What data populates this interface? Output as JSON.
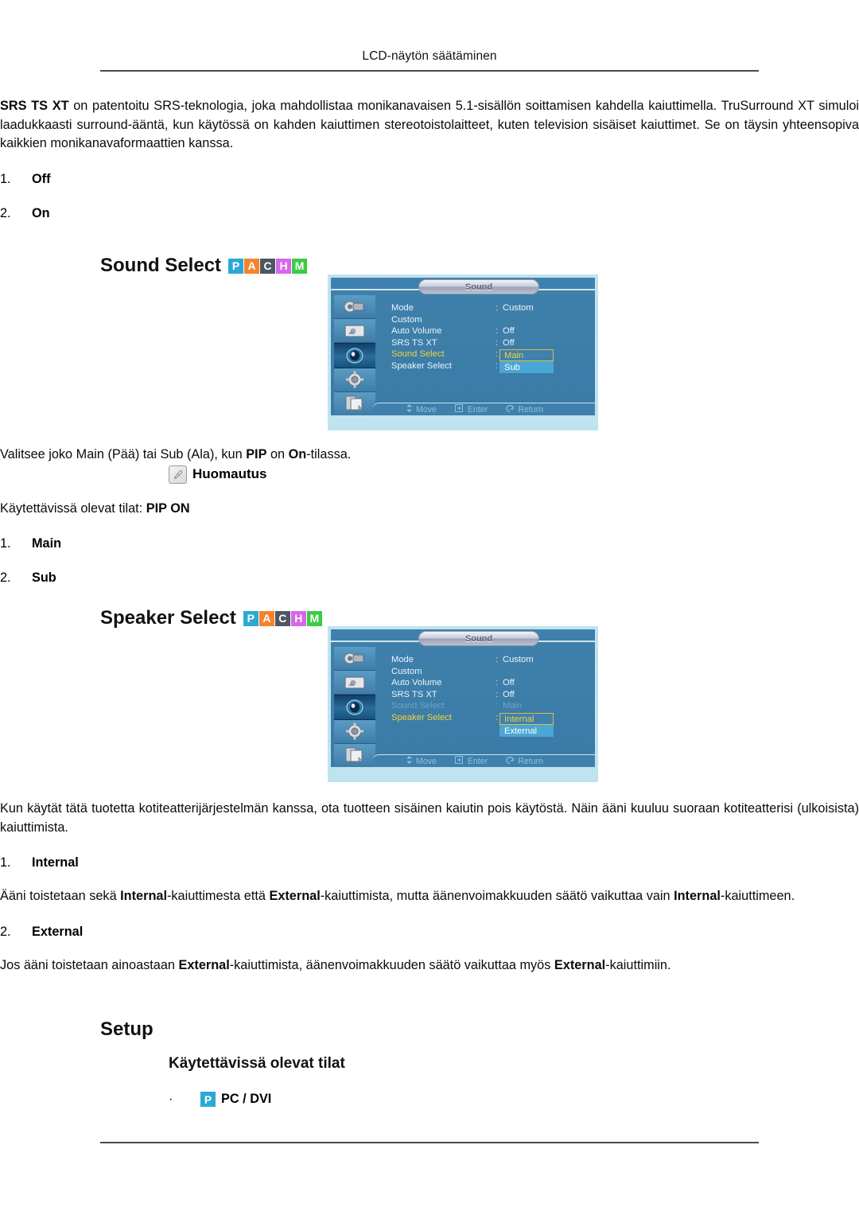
{
  "page": {
    "running_head": "LCD-näytön säätäminen"
  },
  "intro": {
    "paragraph_lead": "SRS TS XT",
    "paragraph_rest": " on patentoitu SRS-teknologia, joka mahdollistaa monikanavaisen 5.1-sisällön soittamisen kahdella kaiuttimella. TruSurround XT simuloi laadukkaasti surround-ääntä, kun käytössä on kahden kaiuttimen stereotoistolaitteet, kuten television sisäiset kaiuttimet. Se on täysin yhteensopiva kaikkien monikanavaformaattien kanssa.",
    "options": [
      {
        "num": "1.",
        "label": "Off"
      },
      {
        "num": "2.",
        "label": "On"
      }
    ]
  },
  "badges": [
    {
      "letter": "P",
      "color": "#2ca8d4"
    },
    {
      "letter": "A",
      "color": "#f4842c"
    },
    {
      "letter": "C",
      "color": "#4e5663"
    },
    {
      "letter": "H",
      "color": "#d866ea"
    },
    {
      "letter": "M",
      "color": "#3ccb44"
    }
  ],
  "pc_badge": {
    "letter": "P",
    "color": "#2ca8d4"
  },
  "sound_select": {
    "heading": "Sound Select",
    "description_pre": "Valitsee joko Main (Pää) tai Sub (Ala), kun ",
    "description_b1": "PIP",
    "description_mid": " on ",
    "description_b2": "On",
    "description_post": "-tilassa.",
    "note_label": "Huomautus",
    "note_icon": "pencil-note-icon",
    "modes_pre": "Käytettävissä olevat tilat: ",
    "modes_value": "PIP ON",
    "options": [
      {
        "num": "1.",
        "label": "Main"
      },
      {
        "num": "2.",
        "label": "Sub"
      }
    ]
  },
  "speaker_select": {
    "heading": "Speaker Select",
    "intro": "Kun käytät tätä tuotetta kotiteatterijärjestelmän kanssa, ota tuotteen sisäinen kaiutin pois käytöstä. Näin ääni kuuluu suoraan kotiteatterisi (ulkoisista) kaiuttimista.",
    "items": [
      {
        "num": "1.",
        "label": "Internal",
        "body_parts": [
          {
            "text": "Ääni toistetaan sekä ",
            "bold": false
          },
          {
            "text": "Internal",
            "bold": true
          },
          {
            "text": "-kaiuttimesta että ",
            "bold": false
          },
          {
            "text": "External",
            "bold": true
          },
          {
            "text": "-kaiuttimista, mutta äänenvoimakkuuden säätö vaikuttaa vain ",
            "bold": false
          },
          {
            "text": "Internal",
            "bold": true
          },
          {
            "text": "-kaiuttimeen.",
            "bold": false
          }
        ]
      },
      {
        "num": "2.",
        "label": "External",
        "body_parts": [
          {
            "text": "Jos ääni toistetaan ainoastaan ",
            "bold": false
          },
          {
            "text": "External",
            "bold": true
          },
          {
            "text": "-kaiuttimista, äänenvoimakkuuden säätö vaikuttaa myös ",
            "bold": false
          },
          {
            "text": "External",
            "bold": true
          },
          {
            "text": "-kaiuttimiin.",
            "bold": false
          }
        ]
      }
    ]
  },
  "setup": {
    "heading": "Setup",
    "subheading": "Käytettävissä olevat tilat",
    "bullet_char": "·",
    "bullet_label": "PC / DVI"
  },
  "osd_common": {
    "title": "Sound",
    "sidebar_icons": [
      "input-source-icon",
      "picture-icon",
      "sound-speaker-icon",
      "setup-gear-icon",
      "multi-control-icon"
    ],
    "footer": [
      {
        "icon": "move-icon",
        "label": "Move"
      },
      {
        "icon": "enter-icon",
        "label": "Enter"
      },
      {
        "icon": "return-icon",
        "label": "Return"
      }
    ],
    "separator": ":"
  },
  "osd_sound_select": {
    "rows": [
      {
        "label": "Mode",
        "value": "Custom",
        "state": "normal"
      },
      {
        "label": "Custom",
        "value": "",
        "state": "normal"
      },
      {
        "label": "Auto Volume",
        "value": "Off",
        "state": "normal"
      },
      {
        "label": "SRS TS XT",
        "value": "Off",
        "state": "normal"
      },
      {
        "label": "Sound Select",
        "value": "",
        "state": "active"
      },
      {
        "label": "Speaker Select",
        "value": "",
        "state": "normal"
      }
    ],
    "options": [
      {
        "label": "Main",
        "focused": true
      },
      {
        "label": "Sub",
        "focused": false
      }
    ]
  },
  "osd_speaker_select": {
    "rows": [
      {
        "label": "Mode",
        "value": "Custom",
        "state": "normal"
      },
      {
        "label": "Custom",
        "value": "",
        "state": "normal"
      },
      {
        "label": "Auto Volume",
        "value": "Off",
        "state": "normal"
      },
      {
        "label": "SRS TS XT",
        "value": "Off",
        "state": "normal"
      },
      {
        "label": "Sound Select",
        "value": "Main",
        "state": "dim"
      },
      {
        "label": "Speaker Select",
        "value": "",
        "state": "active"
      }
    ],
    "options": [
      {
        "label": "Internal",
        "focused": true
      },
      {
        "label": "External",
        "focused": false
      }
    ]
  }
}
